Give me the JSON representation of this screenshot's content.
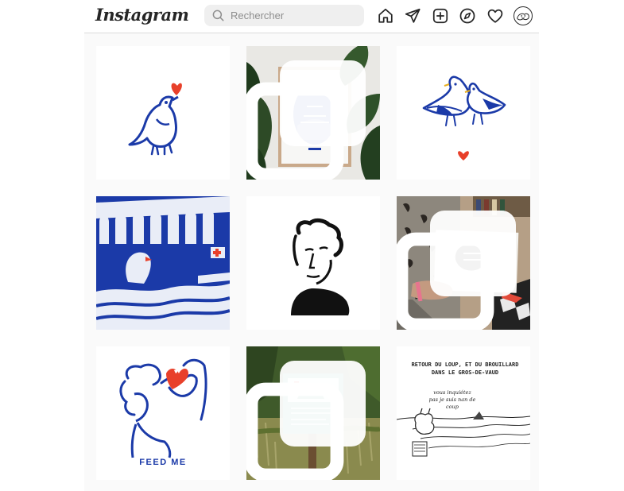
{
  "app": {
    "logo_text": "Instagram"
  },
  "search": {
    "placeholder": "Rechercher",
    "icon": "search-icon"
  },
  "nav": {
    "icons": [
      "home-icon",
      "direct-messages-icon",
      "new-post-icon",
      "explore-icon",
      "activity-heart-icon",
      "profile-avatar"
    ]
  },
  "posts": [
    {
      "subject": "bird-with-heart",
      "multi": false
    },
    {
      "subject": "framed-print-with-plants",
      "multi": true
    },
    {
      "subject": "two-gulls-with-heart",
      "multi": false
    },
    {
      "subject": "bridge-swan-blue-print",
      "multi": false
    },
    {
      "subject": "face-portrait-ink",
      "multi": false
    },
    {
      "subject": "hand-holding-print",
      "multi": true
    },
    {
      "subject": "feed-me-drawing",
      "multi": false,
      "caption": "FEED ME"
    },
    {
      "subject": "sign-in-forest",
      "multi": true
    },
    {
      "subject": "wolf-and-fog-sketch",
      "multi": false,
      "caption_title": "RETOUR DU LOUP, ET DU BROUILLARD DANS LE GROS-DE-VAUD",
      "caption_quote": "vous inquiétez pas je suis nan de coup"
    }
  ],
  "colors": {
    "ink_blue": "#1b3aa8",
    "heart_red": "#e8402a",
    "border": "#dbdbdb",
    "bg": "#fafafa"
  }
}
